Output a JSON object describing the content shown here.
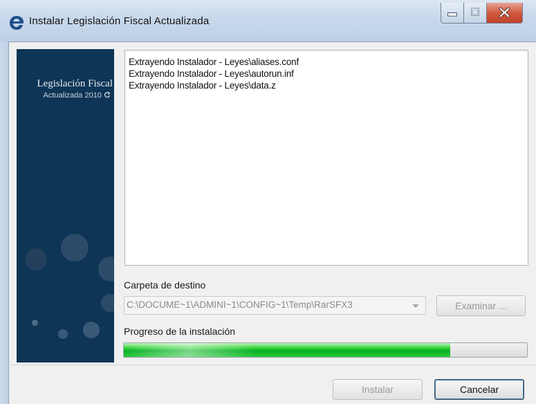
{
  "window": {
    "title": "Instalar Legislación Fiscal Actualizada"
  },
  "banner": {
    "title": "Legislación Fiscal",
    "subtitle": "Actualizada 2010"
  },
  "log": {
    "lines": [
      "Extrayendo Instalador - Leyes\\aliases.conf",
      "Extrayendo Instalador - Leyes\\autorun.inf",
      "Extrayendo Instalador - Leyes\\data.z"
    ]
  },
  "destination": {
    "label": "Carpeta de destino",
    "value": "C:\\DOCUME~1\\ADMINI~1\\CONFIG~1\\Temp\\RarSFX3",
    "browse_label": "Examinar ..."
  },
  "progress": {
    "label": "Progreso de la instalación",
    "fraction": 0.81
  },
  "buttons": {
    "install_label": "Instalar",
    "cancel_label": "Cancelar"
  },
  "colors": {
    "banner_bg": "#0e3556",
    "progress_green": "#06b025",
    "close_red": "#c0402a"
  }
}
